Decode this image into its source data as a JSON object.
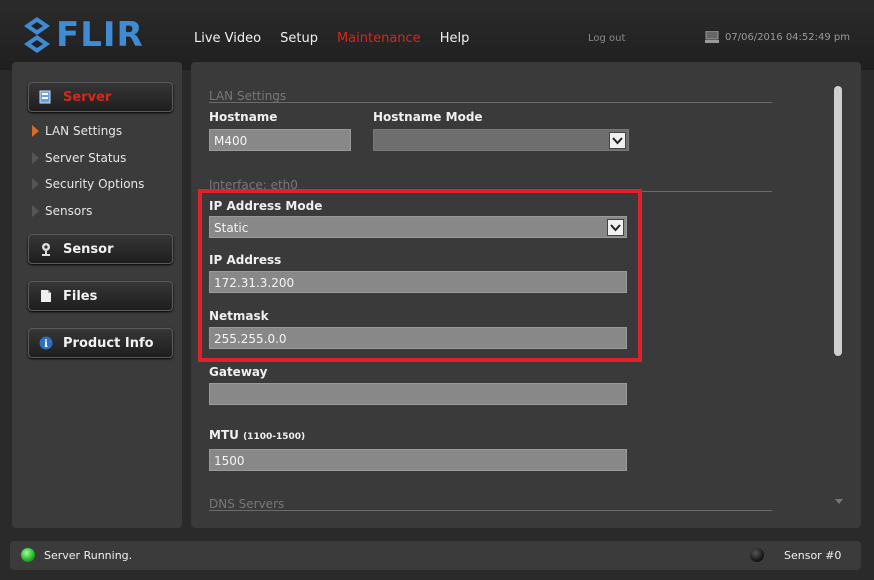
{
  "brand": {
    "logo_text": "FLIR"
  },
  "nav": {
    "items": [
      "Live Video",
      "Setup",
      "Maintenance",
      "Help"
    ],
    "active": "Maintenance",
    "logout": "Log out",
    "datetime": "07/06/2016 04:52:49 pm"
  },
  "sidebar": {
    "server_label": "Server",
    "sub_items": [
      "LAN Settings",
      "Server Status",
      "Security Options",
      "Sensors"
    ],
    "sensor_label": "Sensor",
    "files_label": "Files",
    "product_info_label": "Product Info"
  },
  "form": {
    "lan_section": "LAN Settings",
    "hostname_label": "Hostname",
    "hostname_value": "M400",
    "hostname_mode_label": "Hostname Mode",
    "interface_section": "Interface: eth0",
    "ip_mode_label": "IP Address Mode",
    "ip_mode_value": "Static",
    "ip_label": "IP Address",
    "ip_value": "172.31.3.200",
    "netmask_label": "Netmask",
    "netmask_value": "255.255.0.0",
    "gateway_label": "Gateway",
    "mtu_label": "MTU",
    "mtu_range": "(1100-1500)",
    "mtu_value": "1500",
    "dns_section": "DNS Servers"
  },
  "status": {
    "server_text": "Server Running.",
    "sensor_text": "Sensor #0"
  },
  "colors": {
    "accent": "#d9261c",
    "brand": "#3f8bd4",
    "highlight": "#e0202a"
  }
}
